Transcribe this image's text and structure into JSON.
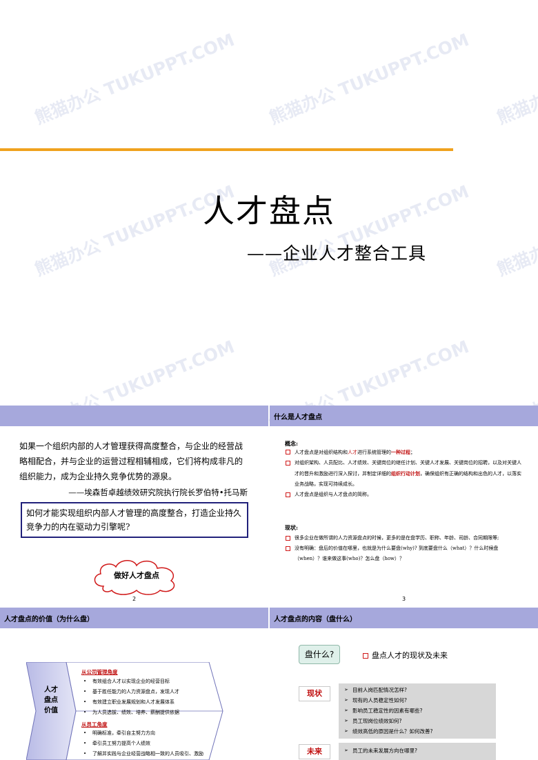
{
  "cover": {
    "title": "人才盘点",
    "subtitle": "——企业人才整合工具",
    "watermark": "熊猫办公 TUKUPPT.COM",
    "rule_color": "#f0a21e"
  },
  "slide2": {
    "quote": "如果一个组织内部的人才管理获得高度整合，与企业的经营战略相配合，并与企业的运营过程相辅相成，它们将构成非凡的组织能力，成为企业持久竞争优势的源泉。",
    "author": "——埃森哲卓越绩效研究院执行院长罗伯特•托马斯",
    "question": "如何才能实现组织内部人才管理的高度整合，打造企业持久竞争力的内在驱动力引擎呢?",
    "cloud_text": "做好人才盘点",
    "page_number": "2"
  },
  "slide3": {
    "header": "什么是人才盘点",
    "concept_label": "概念:",
    "concept_items": [
      {
        "pre": "人才盘点是对组织结构和",
        "hl1": "人才",
        "mid": "进行系统管理的",
        "hl2": "一种过程",
        "post": "；"
      },
      {
        "pre": "对组织架构、人员配比、人才绩效、关键岗位的继任计划、关键人才发展、关键岗位的招聘，以及对关键人才的晋升和激励进行深入探讨，并制定详细的",
        "hl1": "组织行动计划",
        "mid": "，确保组织有正确的结构和出色的人才，以落实业务战略，实现可持续成长。",
        "hl2": "",
        "post": ""
      },
      {
        "pre": "人才盘点是组织与人才盘点的简称。",
        "hl1": "",
        "mid": "",
        "hl2": "",
        "post": ""
      }
    ],
    "status_label": "现状:",
    "status_items": [
      "很多企业在做所谓的人力资源盘点的时候，更多的是在盘学历、职称、年龄、司龄、合同期限等;",
      "没有明确：盘后的价值在哪里，也就是为什么要盘(why)? 到底要盘什么（what）？什么时候盘（when）？谁来做这事(who)？怎么盘（how）？"
    ],
    "page_number": "3"
  },
  "slide4": {
    "header": "人才盘点的价值（为什么盘）",
    "chevron_title": [
      "人才",
      "盘点",
      "价值"
    ],
    "company_title": "从公司管理角度",
    "company_items": [
      "有效组合人才以实现企业的经营目标",
      "基于胜任能力的人力资源盘点，发现人才",
      "有效建立职业发展规划和人才发展体系",
      "为人员选拔、绩效、培养、薪酬提供依据"
    ],
    "employee_title": "从员工角度",
    "employee_items": [
      "明确标准，牵引自主努力方向",
      "牵引员工努力提高个人绩效",
      "了解并实践与企业经营战略相一致的人员吸引、激励"
    ]
  },
  "slide5": {
    "header": "人才盘点的内容（盘什么）",
    "question_tag": "盘什么?",
    "summary": "盘点人才的现状及未来",
    "current_tag": "现状",
    "current_items": [
      "目前人岗匹配情况怎样?",
      "现有的人员稳定性如何?",
      "影响员工稳定性的因素有哪些?",
      "员工现岗位绩效如何?",
      "绩效高低的原因是什么？如何改善?"
    ],
    "future_tag": "未来",
    "future_items": [
      "员工的未来发展方向在哪里?"
    ]
  },
  "colors": {
    "header_bar": "#a6a8dc",
    "accent_red": "#c01010",
    "box_border": "#20207a",
    "cloud_border": "#d01818",
    "question_tag_bg": "#dff0ea"
  }
}
